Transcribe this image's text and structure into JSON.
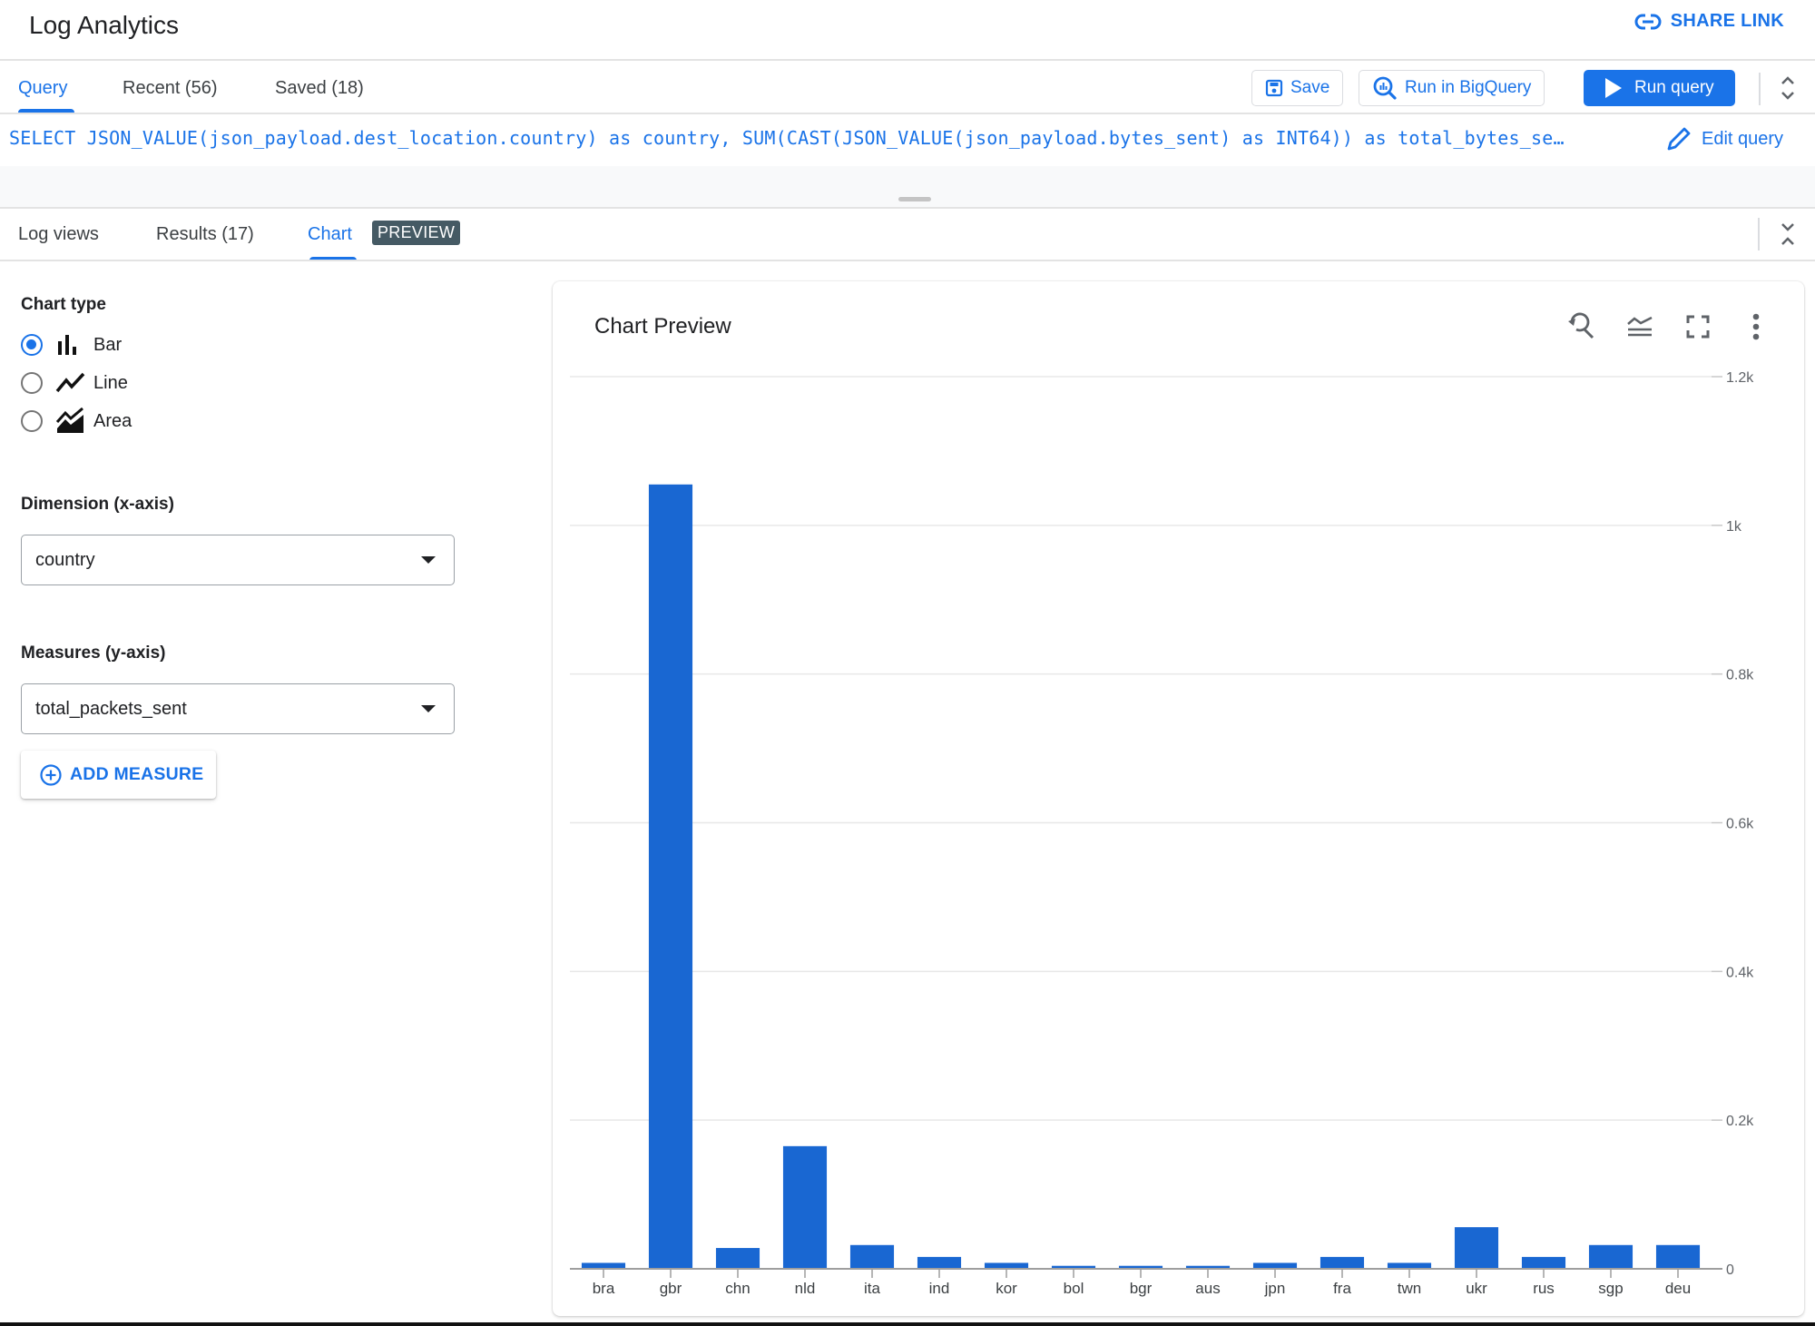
{
  "header": {
    "title": "Log Analytics",
    "share_link_label": "SHARE LINK"
  },
  "query_tabs": [
    {
      "label": "Query",
      "active": true
    },
    {
      "label": "Recent (56)",
      "active": false
    },
    {
      "label": "Saved (18)",
      "active": false
    }
  ],
  "toolbar": {
    "save_label": "Save",
    "run_bigquery_label": "Run in BigQuery",
    "run_query_label": "Run query",
    "edit_query_label": "Edit query"
  },
  "query": {
    "text": "SELECT JSON_VALUE(json_payload.dest_location.country) as country, SUM(CAST(JSON_VALUE(json_payload.bytes_sent) as INT64)) as total_bytes_se…"
  },
  "result_tabs": [
    {
      "label": "Log views",
      "active": false
    },
    {
      "label": "Results (17)",
      "active": false
    },
    {
      "label": "Chart",
      "active": true,
      "badge": "PREVIEW"
    }
  ],
  "chart_config": {
    "chart_type_label": "Chart type",
    "chart_types": [
      {
        "label": "Bar",
        "icon": "bar-chart-icon",
        "selected": true
      },
      {
        "label": "Line",
        "icon": "line-chart-icon",
        "selected": false
      },
      {
        "label": "Area",
        "icon": "area-chart-icon",
        "selected": false
      }
    ],
    "dimension_label": "Dimension (x-axis)",
    "dimension_value": "country",
    "measures_label": "Measures (y-axis)",
    "measure_value": "total_packets_sent",
    "add_measure_label": "ADD MEASURE"
  },
  "chart_card": {
    "title": "Chart Preview",
    "icons": [
      "zoom-reset-icon",
      "legend-icon",
      "fullscreen-icon",
      "more-vert-icon"
    ]
  },
  "colors": {
    "accent": "#1a73e8",
    "bar": "#1967d2",
    "badge": "#455a64"
  },
  "chart_data": {
    "type": "bar",
    "title": "Chart Preview",
    "xlabel": "",
    "ylabel": "",
    "categories": [
      "bra",
      "gbr",
      "chn",
      "nld",
      "ita",
      "ind",
      "kor",
      "bol",
      "bgr",
      "aus",
      "jpn",
      "fra",
      "twn",
      "ukr",
      "rus",
      "sgp",
      "deu"
    ],
    "series": [
      {
        "name": "total_packets_sent",
        "values": [
          8,
          1055,
          28,
          165,
          32,
          16,
          8,
          4,
          4,
          4,
          8,
          16,
          8,
          56,
          16,
          32,
          32
        ]
      }
    ],
    "ylim": [
      0,
      1200
    ],
    "yticks": [
      0,
      200,
      400,
      600,
      800,
      1000,
      1200
    ],
    "ytick_labels": [
      "0",
      "0.2k",
      "0.4k",
      "0.6k",
      "0.8k",
      "1k",
      "1.2k"
    ],
    "y_axis_side": "right",
    "grid": true,
    "legend": "none"
  }
}
